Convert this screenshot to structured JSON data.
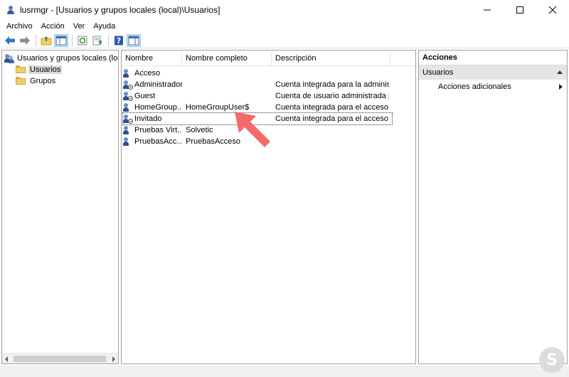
{
  "window": {
    "title": "lusrmgr - [Usuarios y grupos locales (local)\\Usuarios]"
  },
  "menu": [
    "Archivo",
    "Acción",
    "Ver",
    "Ayuda"
  ],
  "tree": {
    "root": "Usuarios y grupos locales (local)",
    "children": [
      "Usuarios",
      "Grupos"
    ],
    "selected": "Usuarios"
  },
  "list": {
    "columns": [
      "Nombre",
      "Nombre completo",
      "Descripción"
    ],
    "rows": [
      {
        "name": "Acceso",
        "full_name": "",
        "description": "",
        "disabled": false
      },
      {
        "name": "Administrador",
        "full_name": "",
        "description": "Cuenta integrada para la administ...",
        "disabled": true
      },
      {
        "name": "Guest",
        "full_name": "",
        "description": "Cuenta de usuario administrada p...",
        "disabled": true
      },
      {
        "name": "HomeGroup...",
        "full_name": "HomeGroupUser$",
        "description": "Cuenta integrada para el acceso d...",
        "disabled": false
      },
      {
        "name": "Invitado",
        "full_name": "",
        "description": "Cuenta integrada para el acceso c...",
        "disabled": true
      },
      {
        "name": "Pruebas Virt...",
        "full_name": "Solvetic",
        "description": "",
        "disabled": false
      },
      {
        "name": "PruebasAcc...",
        "full_name": "PruebasAcceso",
        "description": "",
        "disabled": false
      }
    ],
    "focused_row": "Invitado"
  },
  "actions": {
    "header": "Acciones",
    "section": "Usuarios",
    "items": [
      "Acciones adicionales"
    ]
  },
  "colors": {
    "annotation_arrow": "#f26b6b",
    "tree_selected_bg": "#d9d9d9",
    "actions_section_bg": "#e5e5e5"
  },
  "watermark": {
    "glyph": "S"
  }
}
